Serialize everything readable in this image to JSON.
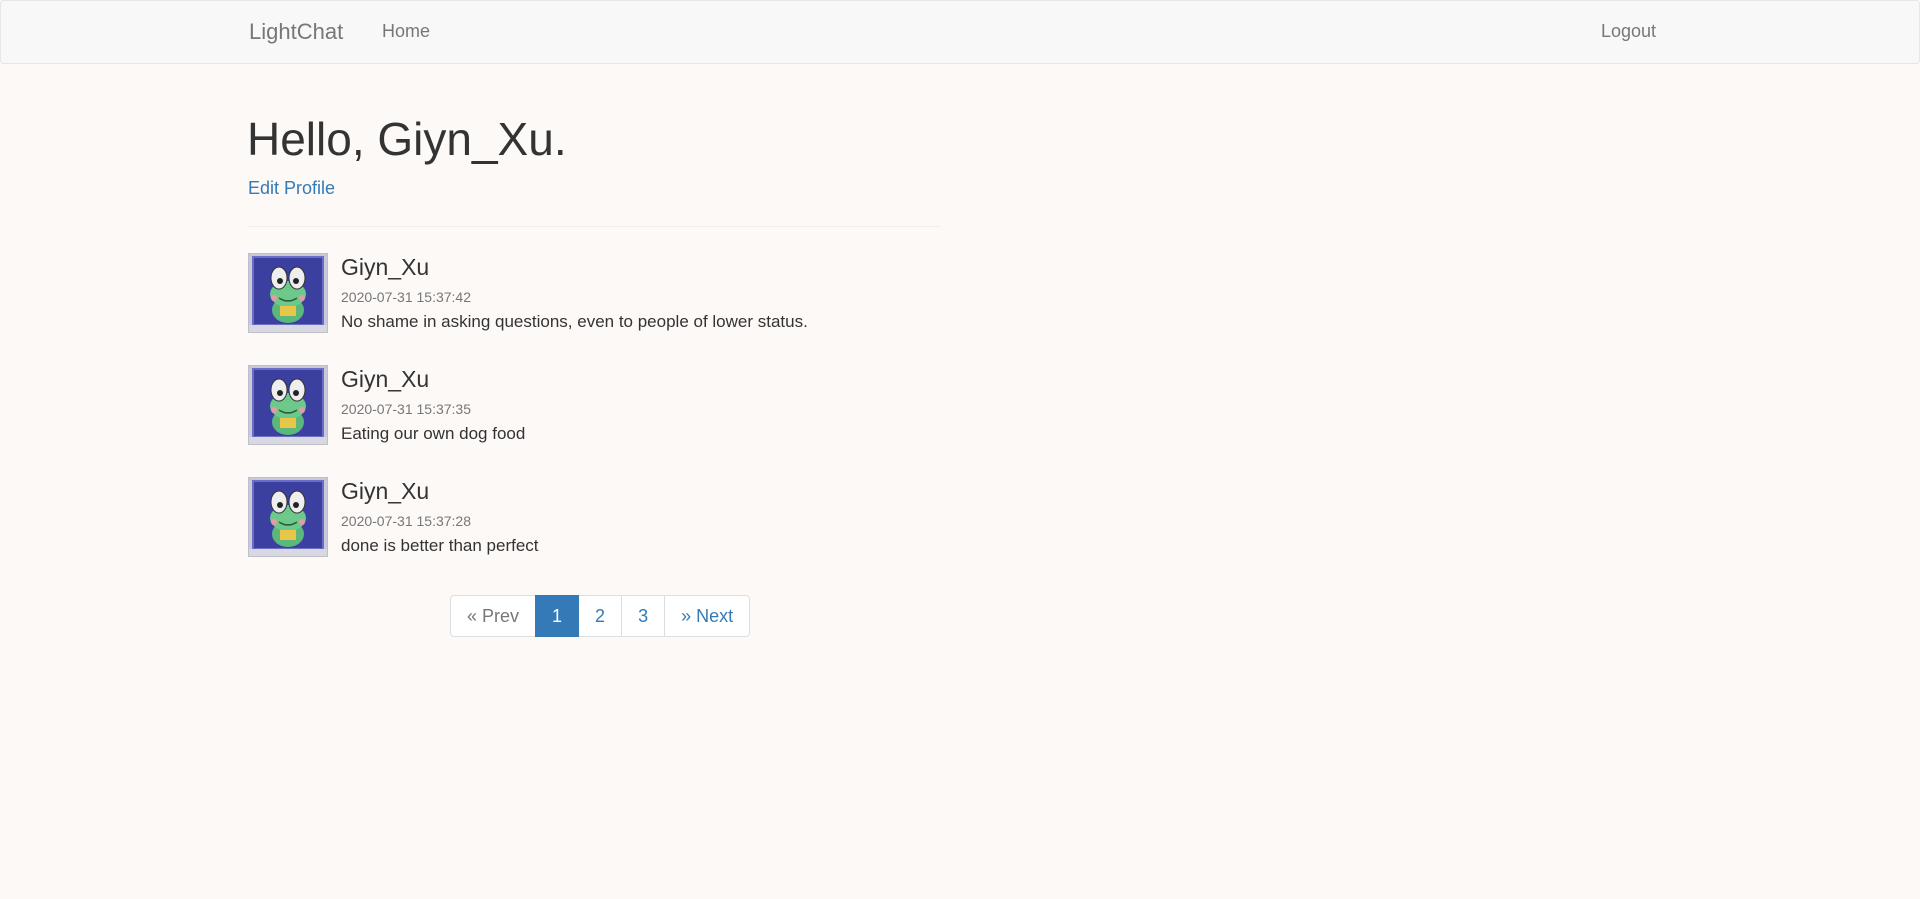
{
  "navbar": {
    "brand": "LightChat",
    "home": "Home",
    "logout": "Logout"
  },
  "header": {
    "greeting": "Hello, Giyn_Xu.",
    "edit_profile": "Edit Profile"
  },
  "posts": [
    {
      "author": "Giyn_Xu",
      "timestamp": "2020-07-31 15:37:42",
      "body": "No shame in asking questions, even to people of lower status.",
      "avatar": "frog-avatar"
    },
    {
      "author": "Giyn_Xu",
      "timestamp": "2020-07-31 15:37:35",
      "body": "Eating our own dog food",
      "avatar": "frog-avatar"
    },
    {
      "author": "Giyn_Xu",
      "timestamp": "2020-07-31 15:37:28",
      "body": "done is better than perfect",
      "avatar": "frog-avatar"
    }
  ],
  "pagination": {
    "prev": "« Prev",
    "pages": [
      "1",
      "2",
      "3"
    ],
    "current": "1",
    "next": "» Next"
  },
  "colors": {
    "link": "#337ab7",
    "active_page_bg": "#337ab7",
    "page_background": "#fdf9f7",
    "navbar_background": "#f8f8f8"
  }
}
